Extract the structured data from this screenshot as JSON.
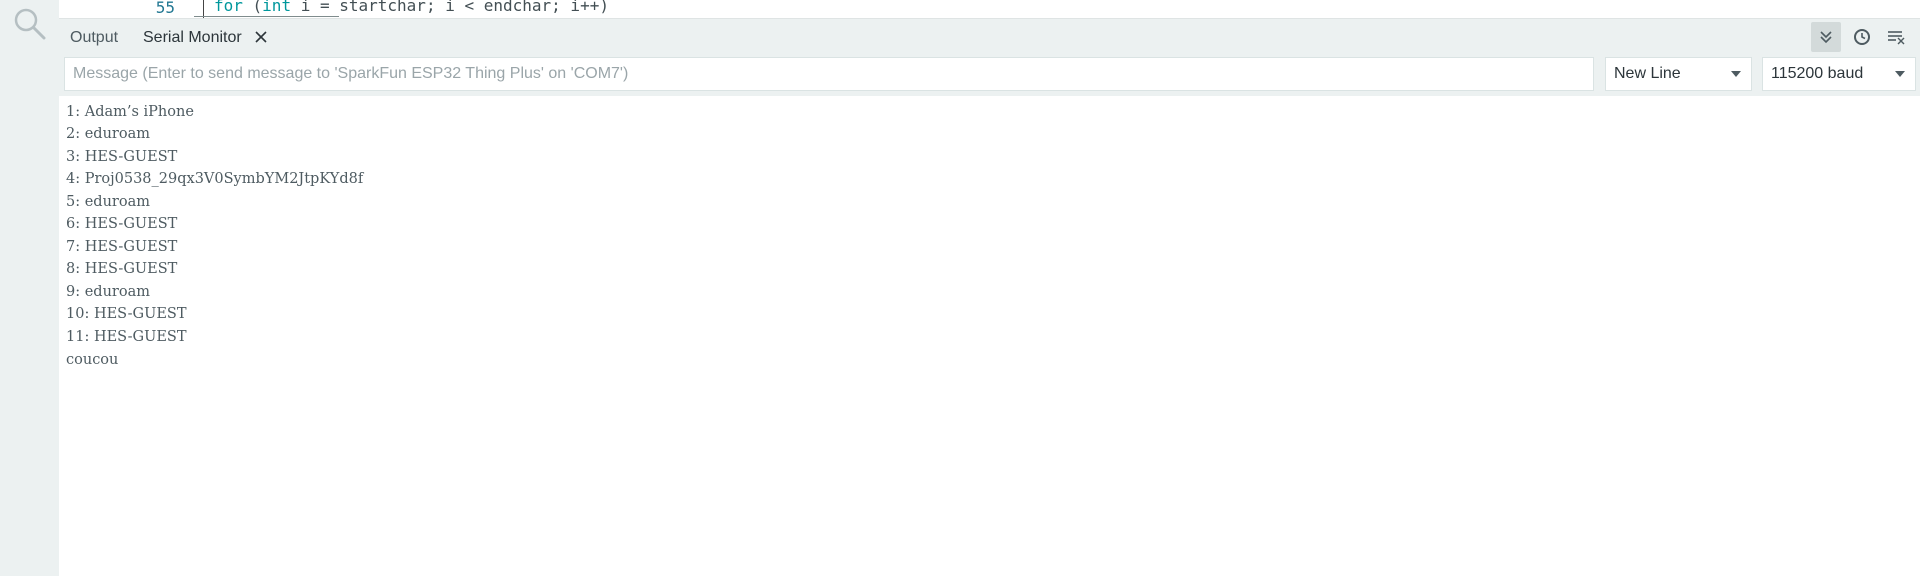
{
  "editor": {
    "line_number": "55",
    "code": {
      "kw_for": "for",
      "paren": " (",
      "kw_int": "int",
      "rest": " i = startchar; i < endchar; i++)"
    }
  },
  "panel": {
    "tabs": [
      {
        "label": "Output"
      },
      {
        "label": "Serial Monitor"
      }
    ],
    "buttons": {
      "autoscroll": "autoscroll-icon",
      "timestamp": "clock-icon",
      "clear": "clear-output-icon"
    }
  },
  "message_row": {
    "placeholder": "Message (Enter to send message to 'SparkFun ESP32 Thing Plus' on 'COM7')",
    "value": "",
    "line_ending": "New Line",
    "baud": "115200 baud"
  },
  "output_lines": [
    "1: Adam’s iPhone",
    "2: eduroam",
    "3: HES-GUEST",
    "4: Proj0538_29qx3V0SymbYM2JtpKYd8f",
    "5: eduroam",
    "6: HES-GUEST",
    "7: HES-GUEST",
    "8: HES-GUEST",
    "9: eduroam",
    "10: HES-GUEST",
    "11: HES-GUEST",
    "coucou"
  ],
  "colors": {
    "panel_bg": "#ecf1f1",
    "text": "#4e5b61",
    "accent": "#00979c"
  }
}
